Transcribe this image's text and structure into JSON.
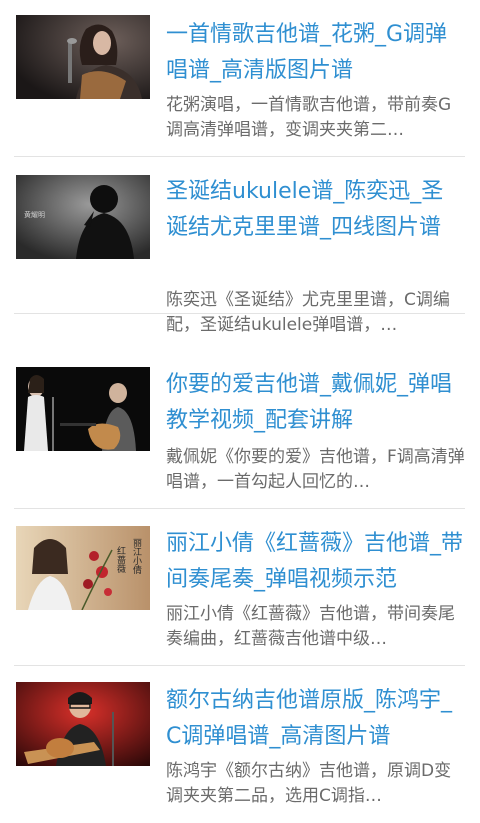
{
  "articles": [
    {
      "title": "一首情歌吉他谱_花粥_G调弹唱谱_高清版图片谱",
      "desc": "花粥演唱，一首情歌吉他谱，带前奏G调高清弹唱谱，变调夹夹第二…",
      "thumb": "woman-singing-with-guitar-icon"
    },
    {
      "title": "圣诞结ukulele谱_陈奕迅_圣诞结尤克里里谱_四线图片谱",
      "desc": "陈奕迅《圣诞结》尤克里里谱，C调编配，圣诞结ukulele弹唱谱，…",
      "thumb": "singer-silhouette-icon",
      "thumb_caption": "黄耀明"
    },
    {
      "title": "你要的爱吉他谱_戴佩妮_弹唱教学视频_配套讲解",
      "desc": "戴佩妮《你要的爱》吉他谱，F调高清弹唱谱，一首勾起人回忆的…",
      "thumb": "singer-and-guitarist-icon"
    },
    {
      "title": "丽江小倩《红蔷薇》吉他谱_带间奏尾奏_弹唱视频示范",
      "desc": "丽江小倩《红蔷薇》吉他谱，带间奏尾奏编曲，红蔷薇吉他谱中级…",
      "thumb": "album-cover-roses-icon",
      "thumb_text_a": "红蔷薇",
      "thumb_text_b": "丽江小倩"
    },
    {
      "title": "额尔古纳吉他谱原版_陈鸿宇_C调弹唱谱_高清图片谱",
      "desc": "陈鸿宇《额尔古纳》吉他谱，原调D变调夹夹第二品，选用C调指…",
      "thumb": "guitarist-on-stage-icon"
    }
  ]
}
